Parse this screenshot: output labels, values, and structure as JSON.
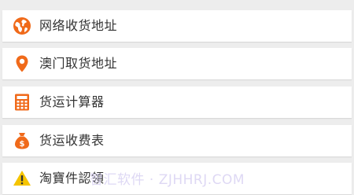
{
  "menu": {
    "items": [
      {
        "label": "网络收货地址",
        "icon": "globe-icon"
      },
      {
        "label": "澳门取货地址",
        "icon": "map-pin-icon"
      },
      {
        "label": "货运计算器",
        "icon": "calculator-icon"
      },
      {
        "label": "货运收费表",
        "icon": "money-bag-icon"
      },
      {
        "label": "淘寶件認領",
        "icon": "warning-icon"
      }
    ]
  },
  "colors": {
    "accent": "#f06a1a",
    "warning": "#f5c400",
    "background": "#ededed"
  },
  "watermark": "智汇软件 · ZJHHRJ.COM"
}
